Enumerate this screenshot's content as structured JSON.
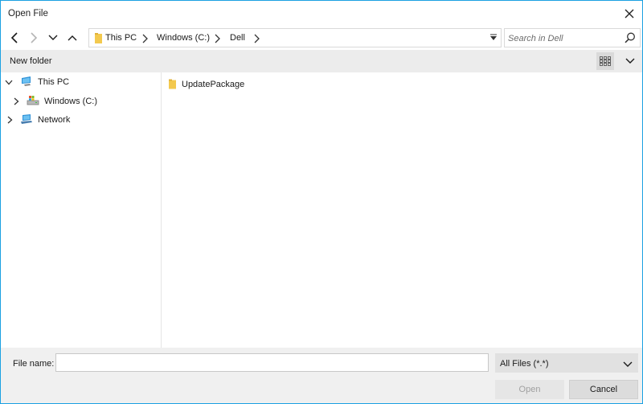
{
  "window": {
    "title": "Open File"
  },
  "nav": {
    "back_icon": "chevron-left-icon",
    "forward_icon": "chevron-right-icon",
    "recent_icon": "chevron-down-icon",
    "up_icon": "arrow-up-icon"
  },
  "address": {
    "crumbs": [
      "This PC",
      "Windows (C:)",
      "Dell"
    ]
  },
  "search": {
    "placeholder": "Search in  Dell"
  },
  "command_bar": {
    "new_folder_label": "New folder"
  },
  "tree": {
    "items": [
      {
        "label": "This PC",
        "icon": "computer-icon",
        "expanded": true
      },
      {
        "label": "Windows (C:)",
        "icon": "drive-icon",
        "expanded": false
      },
      {
        "label": "Network",
        "icon": "network-icon",
        "expanded": false
      }
    ]
  },
  "files": {
    "items": [
      {
        "name": "UpdatePackage",
        "icon": "folder-icon"
      }
    ]
  },
  "bottom": {
    "file_name_label": "File name:",
    "file_name_value": "",
    "filter_value": "All Files (*.*)",
    "open_label": "Open",
    "cancel_label": "Cancel"
  },
  "colors": {
    "border_accent": "#1ba1e2",
    "command_bar_bg": "#ececec",
    "folder_yellow": "#f3c94e"
  }
}
